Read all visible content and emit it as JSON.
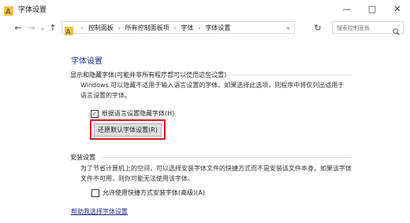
{
  "window": {
    "title": "字体设置",
    "controls": {
      "minimize": "—",
      "maximize": "□",
      "close": "✕"
    }
  },
  "nav": {
    "back_icon": "←",
    "forward_icon": "→",
    "history_icon": "⌄",
    "up_icon": "↑",
    "breadcrumbs": [
      "控制面板",
      "所有控制面板项",
      "字体",
      "字体设置"
    ],
    "separator": "›",
    "address_dropdown_icon": "⌄",
    "refresh_icon": "↻",
    "search_placeholder": "搜索控制面板"
  },
  "page": {
    "title": "字体设置",
    "section1": {
      "label": "显示和隐藏字体(可能并非所有程序都可以使用这些设置)",
      "description": "Windows 可以隐藏不适用于输入语言设置的字体。如果选择此选项，则程序中将仅列出适用于语言设置的字体。",
      "checkbox_label": "根据语言设置隐藏字体(H)",
      "checkbox_checked": true,
      "checkbox_mark": "✓",
      "restore_button": "还原默认字体设置(R)"
    },
    "section2": {
      "label": "安装设置",
      "description": "为了节省计算机上的空间，可以选择安装字体文件的快捷方式而不是安装该文件本身。如果该字体文件不可用，则你可能无法使用该字体。",
      "checkbox_label": "允许使用快捷方式安装字体(高级)(A)",
      "checkbox_checked": false
    },
    "help_link": "帮助我选择字体设置"
  },
  "colors": {
    "link_blue": "#1e3287",
    "highlight_red": "#cc1f1f",
    "folder_yellow": "#f2c14e"
  }
}
